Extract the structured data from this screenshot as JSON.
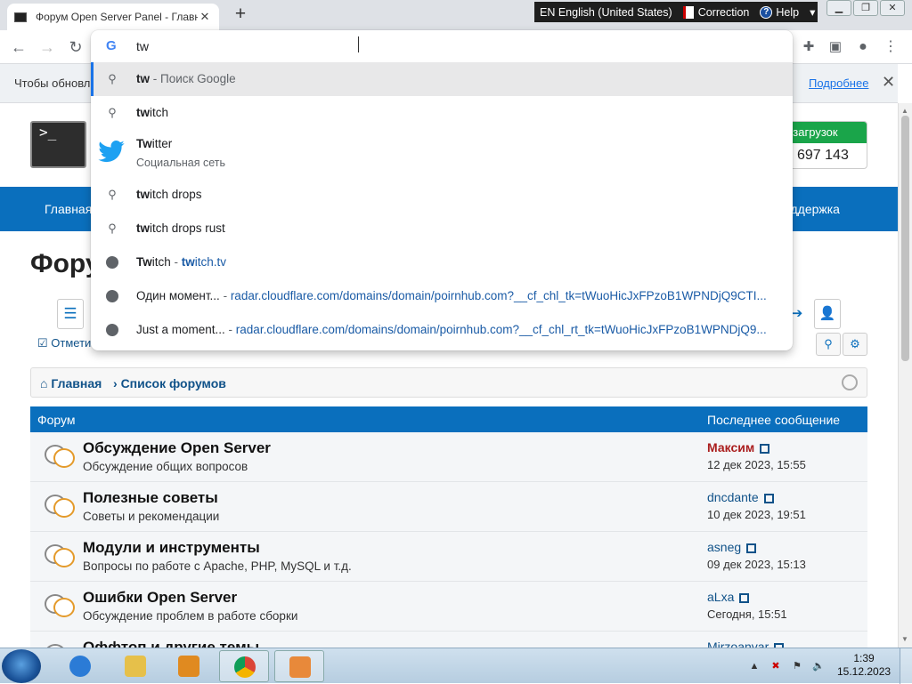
{
  "browser": {
    "tab_title": "Форум Open Server Panel - Главная",
    "tab_close": "✕",
    "new_tab": "+"
  },
  "language_bar": {
    "language": "EN English (United States)",
    "correction": "Correction",
    "help": "Help"
  },
  "omnibox": {
    "query": "tw",
    "suggestions": [
      {
        "kind": "search",
        "bold": "tw",
        "rest": "",
        "sub": " - Поиск Google",
        "selected": true
      },
      {
        "kind": "search",
        "bold": "tw",
        "rest": "itch",
        "sub": "",
        "selected": false
      },
      {
        "kind": "twitter",
        "bold": "Tw",
        "rest": "itter",
        "sub": "Социальная сеть",
        "selected": false
      },
      {
        "kind": "search",
        "bold": "tw",
        "rest": "itch drops",
        "sub": "",
        "selected": false
      },
      {
        "kind": "search",
        "bold": "tw",
        "rest": "itch drops rust",
        "sub": "",
        "selected": false
      },
      {
        "kind": "site",
        "bold": "Tw",
        "rest": "itch",
        "sub": " - ",
        "url_bold": "tw",
        "url_rest": "itch.tv",
        "selected": false
      },
      {
        "kind": "site",
        "bold": "",
        "rest": "Один момент...",
        "sub": " - ",
        "url_bold": "",
        "url_rest": "radar.cloudflare.com/domains/domain/poirnhub.com?__cf_chl_tk=tWuoHicJxFPzoB1WPNDjQ9CTI...",
        "selected": false
      },
      {
        "kind": "site",
        "bold": "",
        "rest": "Just a moment...",
        "sub": " - ",
        "url_bold": "",
        "url_rest": "radar.cloudflare.com/domains/domain/poirnhub.com?__cf_chl_rt_tk=tWuoHicJxFPzoB1WPNDjQ9...",
        "selected": false
      }
    ]
  },
  "infobar": {
    "text": "Чтобы обновл",
    "more": "Подробнее",
    "close": "✕"
  },
  "site": {
    "logo_text": ">_",
    "downloads_label": "го загрузок",
    "downloads_count": "697 143",
    "nav_left": "Главная",
    "nav_right": "оддержка",
    "page_title": "Фору",
    "mark_read": "Отмети",
    "crumb_home": "Главная",
    "crumb_list": "Список форумов",
    "head_forum": "Форум",
    "head_last": "Последнее сообщение",
    "forums": [
      {
        "title": "Обсуждение Open Server",
        "desc": "Обсуждение общих вопросов",
        "user": "Максим",
        "time": "12 дек 2023, 15:55",
        "user_red": true
      },
      {
        "title": "Полезные советы",
        "desc": "Советы и рекомендации",
        "user": "dncdante",
        "time": "10 дек 2023, 19:51",
        "user_red": false
      },
      {
        "title": "Модули и инструменты",
        "desc": "Вопросы по работе с Apache, PHP, MySQL и т.д.",
        "user": "asneg",
        "time": "09 дек 2023, 15:13",
        "user_red": false
      },
      {
        "title": "Ошибки Open Server",
        "desc": "Обсуждение проблем в работе сборки",
        "user": "aLxa",
        "time": "Сегодня, 15:51",
        "user_red": false
      },
      {
        "title": "Оффтоп и другие темы",
        "desc": "",
        "user": "Mirzoanvar",
        "time": "",
        "user_red": false
      }
    ]
  },
  "taskbar": {
    "time": "1:39",
    "date": "15.12.2023"
  },
  "colors": {
    "nav_blue": "#0a6fbd",
    "link_blue": "#105289",
    "downloads_green": "#1aa54a",
    "user_red": "#aa1e1e"
  }
}
